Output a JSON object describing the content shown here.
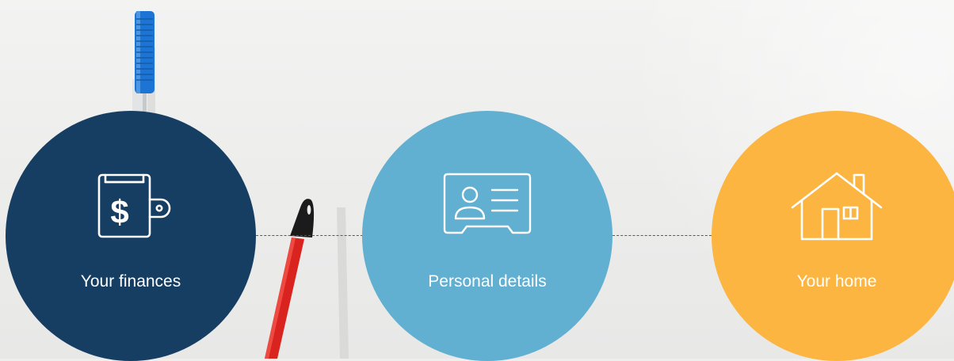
{
  "steps": [
    {
      "label": "Your finances",
      "icon": "wallet-dollar-icon",
      "color": "#163e63"
    },
    {
      "label": "Personal details",
      "icon": "id-card-icon",
      "color": "#61afd1"
    },
    {
      "label": "Your home",
      "icon": "house-icon",
      "color": "#fbb540"
    }
  ],
  "colors": {
    "background": "#eeeeed",
    "connector": "#555a60",
    "label_text": "#ffffff"
  }
}
